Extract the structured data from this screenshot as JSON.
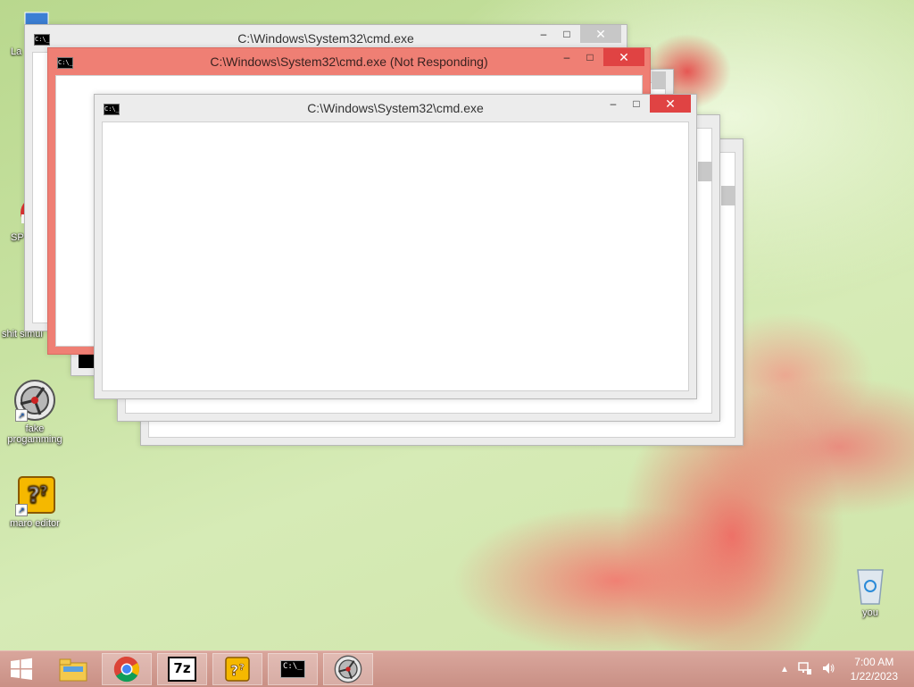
{
  "desktop": {
    "icons": [
      {
        "label": "La"
      },
      {
        "label": "SP"
      },
      {
        "label": "shit simul"
      },
      {
        "label": "fake progamming"
      },
      {
        "label": "maro editor"
      },
      {
        "label": "you"
      }
    ]
  },
  "windows": [
    {
      "title": "C:\\Windows\\System32\\cmd.exe",
      "state": "normal"
    },
    {
      "title": "C:\\Windows\\System32\\cmd.exe (Not Responding)",
      "state": "not-responding"
    },
    {
      "title": "C:\\Windows\\System32\\cmd.exe",
      "state": "active"
    }
  ],
  "window_buttons": {
    "minimize": "‒",
    "maximize": "□",
    "close": "✕"
  },
  "cmd_icon_text": "C:\\_",
  "taskbar": {
    "items": [
      {
        "icon": "start-icon"
      },
      {
        "icon": "file-explorer-icon"
      },
      {
        "icon": "chrome-icon"
      },
      {
        "icon": "7zip-icon",
        "text": "7z"
      },
      {
        "icon": "question-block-icon"
      },
      {
        "icon": "cmd-icon"
      },
      {
        "icon": "fake-programming-icon"
      }
    ],
    "clock_time": "7:00 AM",
    "clock_date": "1/22/2023"
  },
  "colors": {
    "not_responding": "#ef7f74",
    "close_active": "#e04343",
    "taskbar": "#d0998f"
  }
}
